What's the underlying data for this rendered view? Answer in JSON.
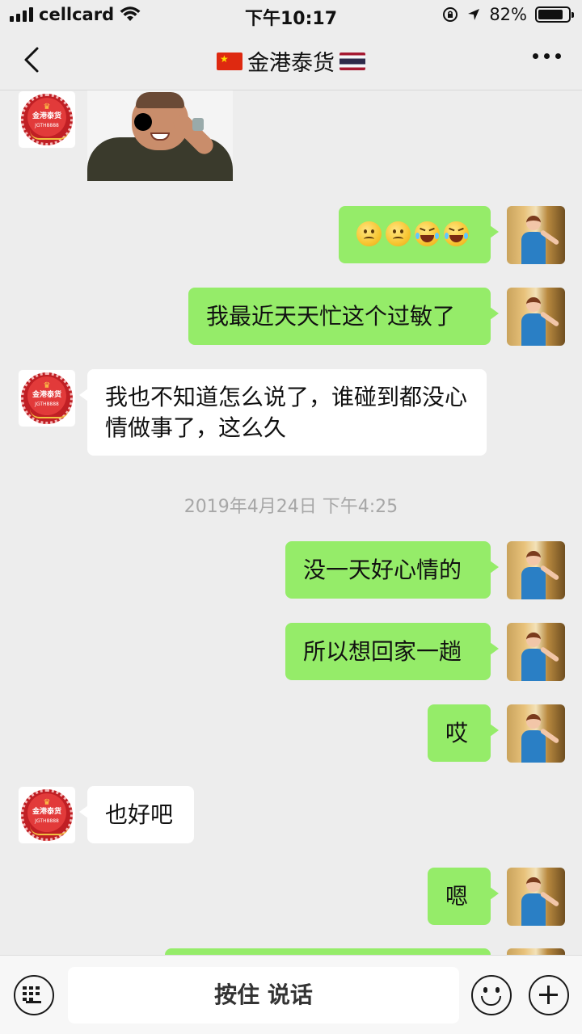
{
  "status_bar": {
    "carrier": "cellcard",
    "time": "下午10:17",
    "battery_percent": "82%",
    "battery_level": 0.82
  },
  "nav": {
    "title": "金港泰货",
    "left_flag": "china-flag",
    "right_flag": "thailand-flag"
  },
  "shop_avatar": {
    "name": "金港泰货",
    "id": "JGTH8888"
  },
  "messages": [
    {
      "side": "in",
      "type": "image",
      "content": "sticker-man-eyepatch"
    },
    {
      "side": "out",
      "type": "emoji",
      "emojis": [
        "frown-emoji",
        "frown-emoji",
        "laugh-tears-emoji",
        "laugh-tears-emoji"
      ]
    },
    {
      "side": "out",
      "type": "text",
      "text": "我最近天天忙这个过敏了"
    },
    {
      "side": "in",
      "type": "text",
      "text": "我也不知道怎么说了，谁碰到都没心情做事了，这么久"
    },
    {
      "side": "out",
      "type": "text",
      "text": "没一天好心情的"
    },
    {
      "side": "out",
      "type": "text",
      "text": "所以想回家一趟"
    },
    {
      "side": "out",
      "type": "text",
      "text": "哎"
    },
    {
      "side": "in",
      "type": "text",
      "text": "也好吧"
    },
    {
      "side": "out",
      "type": "text",
      "text": "嗯"
    }
  ],
  "timestamp": "2019年4月24日 下午4:25",
  "input_bar": {
    "hold_to_talk": "按住 说话"
  }
}
